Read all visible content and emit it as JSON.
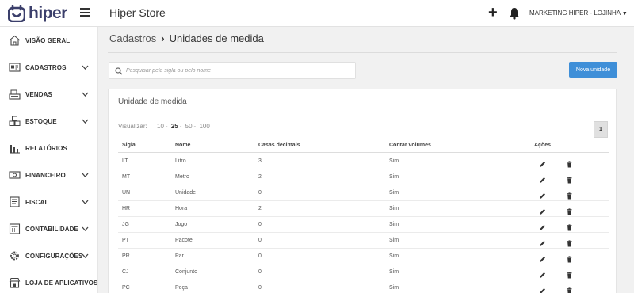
{
  "header": {
    "logo_text": "hiper",
    "store_title": "Hiper Store",
    "user_menu": "MARKETING HIPER - LOJINHA"
  },
  "sidebar": {
    "items": [
      {
        "label": "VISÃO GERAL",
        "icon": "house-icon",
        "has_chevron": false
      },
      {
        "label": "CADASTROS",
        "icon": "id-card-icon",
        "has_chevron": true
      },
      {
        "label": "VENDAS",
        "icon": "cash-register-icon",
        "has_chevron": true
      },
      {
        "label": "ESTOQUE",
        "icon": "boxes-icon",
        "has_chevron": true
      },
      {
        "label": "RELATÓRIOS",
        "icon": "bar-chart-icon",
        "has_chevron": false
      },
      {
        "label": "FINANCEIRO",
        "icon": "money-icon",
        "has_chevron": true
      },
      {
        "label": "FISCAL",
        "icon": "document-icon",
        "has_chevron": true
      },
      {
        "label": "CONTABILIDADE",
        "icon": "calculator-icon",
        "has_chevron": true
      },
      {
        "label": "CONFIGURAÇÕES",
        "icon": "gear-icon",
        "has_chevron": true
      },
      {
        "label": "LOJA DE APLICATIVOS",
        "icon": "store-icon",
        "has_chevron": false
      }
    ]
  },
  "breadcrumb": {
    "parent": "Cadastros",
    "separator": "›",
    "current": "Unidades de medida"
  },
  "search": {
    "placeholder": "Pesquisar pela sigla ou pelo nome",
    "value": ""
  },
  "actions": {
    "new_button": "Nova unidade"
  },
  "card": {
    "title": "Unidade de medida",
    "view_label": "Visualizar:",
    "view_options": [
      "10",
      "25",
      "50",
      "100"
    ],
    "view_selected": "25",
    "page": "1"
  },
  "table": {
    "headers": {
      "sigla": "Sigla",
      "nome": "Nome",
      "casas": "Casas decimais",
      "volumes": "Contar volumes",
      "acoes": "Ações"
    },
    "rows": [
      {
        "sigla": "LT",
        "nome": "Litro",
        "casas": "3",
        "volumes": "Sim"
      },
      {
        "sigla": "MT",
        "nome": "Metro",
        "casas": "2",
        "volumes": "Sim"
      },
      {
        "sigla": "UN",
        "nome": "Unidade",
        "casas": "0",
        "volumes": "Sim"
      },
      {
        "sigla": "HR",
        "nome": "Hora",
        "casas": "2",
        "volumes": "Sim"
      },
      {
        "sigla": "JG",
        "nome": "Jogo",
        "casas": "0",
        "volumes": "Sim"
      },
      {
        "sigla": "PT",
        "nome": "Pacote",
        "casas": "0",
        "volumes": "Sim"
      },
      {
        "sigla": "PR",
        "nome": "Par",
        "casas": "0",
        "volumes": "Sim"
      },
      {
        "sigla": "CJ",
        "nome": "Conjunto",
        "casas": "0",
        "volumes": "Sim"
      },
      {
        "sigla": "PC",
        "nome": "Peça",
        "casas": "0",
        "volumes": "Sim"
      }
    ]
  },
  "colors": {
    "brand": "#3b3f6b",
    "primary_button": "#3f8fd8",
    "background": "#f1f1f1"
  }
}
